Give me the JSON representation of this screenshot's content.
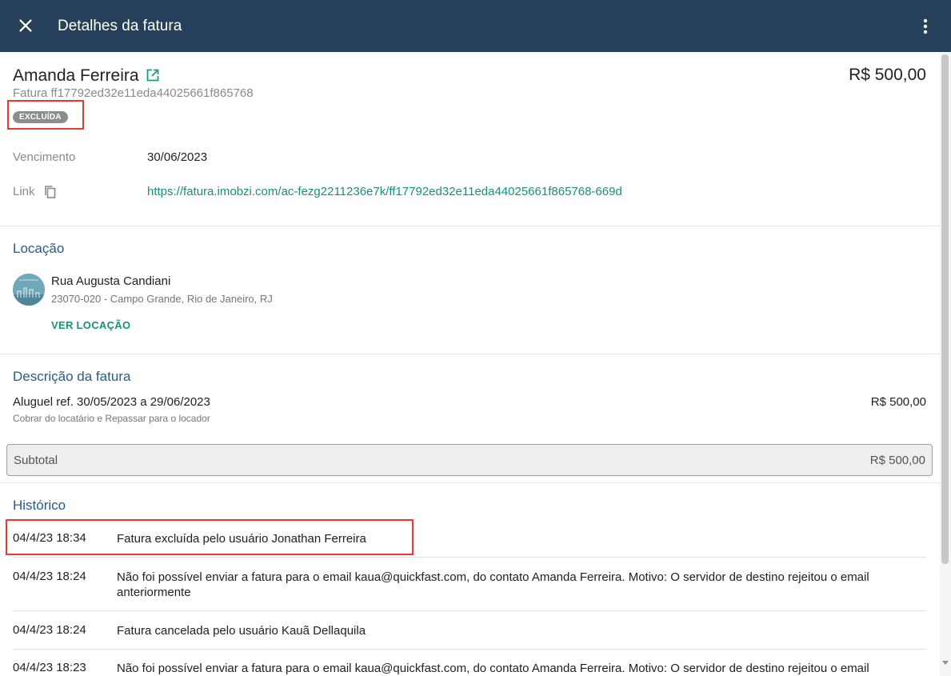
{
  "header": {
    "title": "Detalhes da fatura",
    "close_icon": "close-icon",
    "menu_icon": "more-vertical-icon",
    "background": "#263f5a"
  },
  "invoice": {
    "customer_name": "Amanda Ferreira",
    "open_icon": "open-in-new-icon",
    "id_label": "Fatura ff17792ed32e11eda44025661f865768",
    "amount": "R$ 500,00",
    "status": "EXCLUÍDA",
    "due_label": "Vencimento",
    "due_date": "30/06/2023",
    "link_label": "Link",
    "copy_icon": "copy-icon",
    "link_url": "https://fatura.imobzi.com/ac-fezg2211236e7k/ff17792ed32e11eda44025661f865768-669d"
  },
  "location": {
    "title": "Locação",
    "street": "Rua Augusta Candiani",
    "city": "23070-020 - Campo Grande, Rio de Janeiro, RJ",
    "button": "VER LOCAÇÃO"
  },
  "description": {
    "title": "Descrição da fatura",
    "item": "Aluguel ref. 30/05/2023 a 29/06/2023",
    "item_sub": "Cobrar do locatário e Repassar para o locador",
    "item_amount": "R$ 500,00",
    "subtotal_label": "Subtotal",
    "subtotal_value": "R$ 500,00"
  },
  "history": {
    "title": "Histórico",
    "rows": [
      {
        "date": "04/4/23 18:34",
        "text": "Fatura excluída pelo usuário Jonathan Ferreira"
      },
      {
        "date": "04/4/23 18:24",
        "text": "Não foi possível enviar a fatura para o email kaua@quickfast.com, do contato Amanda Ferreira. Motivo: O servidor de destino rejeitou o email anteriormente"
      },
      {
        "date": "04/4/23 18:24",
        "text": "Fatura cancelada pelo usuário Kauã Dellaquila"
      },
      {
        "date": "04/4/23 18:23",
        "text": "Não foi possível enviar a fatura para o email kaua@quickfast.com, do contato Amanda Ferreira. Motivo: O servidor de destino rejeitou o email anteriormente"
      }
    ]
  },
  "colors": {
    "accent_link": "#1a8f7a",
    "section_title": "#2b5b84",
    "highlight": "#e53935"
  }
}
